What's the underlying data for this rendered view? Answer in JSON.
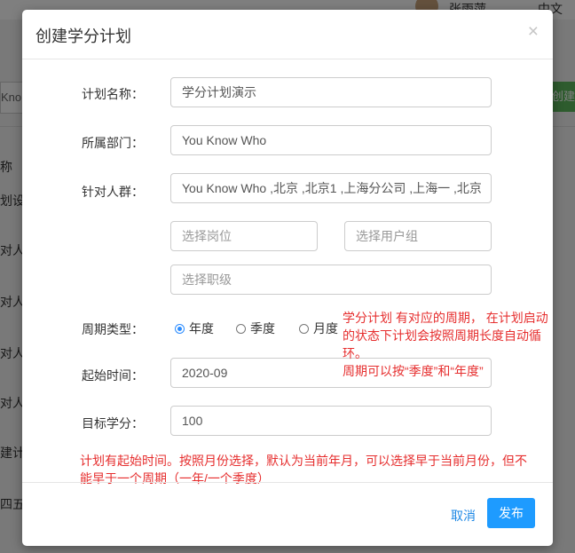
{
  "background": {
    "user_name": "张雨萍",
    "language": "中文",
    "search_value": "Kno",
    "create_button": "创建",
    "rows": [
      "称",
      "划设置",
      "对人群",
      "对人群",
      "对人群",
      "对人群",
      "建计划",
      "四五六"
    ]
  },
  "modal": {
    "title": "创建学分计划",
    "close_icon": "×",
    "labels": {
      "plan_name": "计划名称：",
      "department": "所属部门：",
      "audience": "针对人群：",
      "cycle_type": "周期类型：",
      "start_time": "起始时间：",
      "target_credit": "目标学分："
    },
    "fields": {
      "plan_name": "学分计划演示",
      "department": "You Know Who",
      "audience": "You Know Who ,北京 ,北京1 ,上海分公司 ,上海一 ,北京",
      "position_placeholder": "选择岗位",
      "user_group_placeholder": "选择用户组",
      "rank_placeholder": "选择职级",
      "start_time": "2020-09",
      "target_credit": "100"
    },
    "cycle_options": [
      {
        "label": "年度",
        "selected": true
      },
      {
        "label": "季度",
        "selected": false
      },
      {
        "label": "月度",
        "selected": false
      }
    ],
    "annotations": {
      "cycle_note_1": "学分计划 有对应的周期， 在计划启动",
      "cycle_note_2": "的状态下计划会按照周期长度自动循",
      "cycle_note_3": "环。",
      "cycle_note_4": "周期可以按“季度”和“年度”",
      "start_note_1": "计划有起始时间。按照月份选择，默认为当前年月，可以选择早于当前月份，但不",
      "start_note_2": "能早于一个周期（一年/一个季度）"
    },
    "buttons": {
      "cancel": "取消",
      "publish": "发布"
    },
    "colors": {
      "accent": "#1e9bff",
      "annotation": "#e62e2e"
    }
  }
}
